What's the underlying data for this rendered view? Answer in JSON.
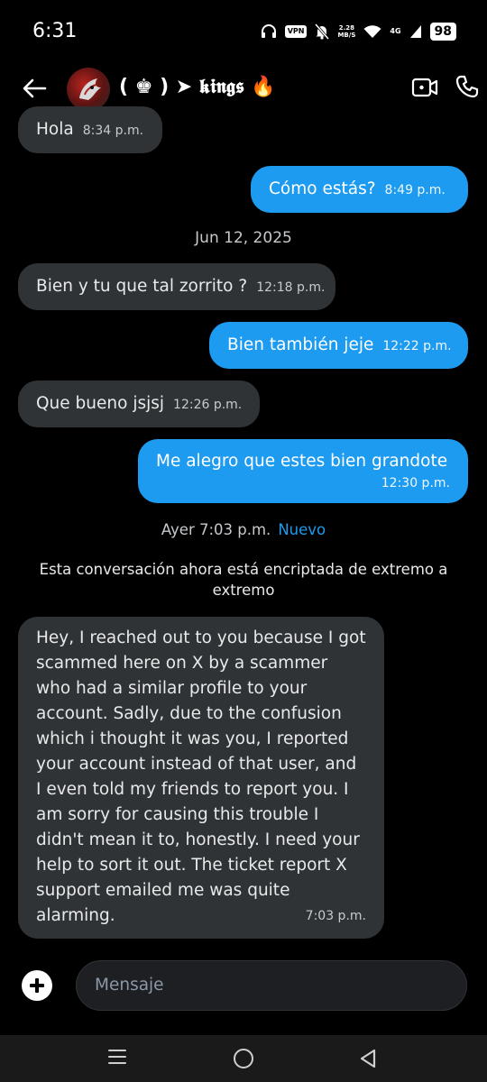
{
  "status_bar": {
    "time": "6:31",
    "vpn": "VPN",
    "speed_top": "2.28",
    "speed_bottom": "MB/S",
    "network": "4G",
    "battery": "98"
  },
  "header": {
    "title": "( ♚ ) ➤ 𝖐𝖎𝖓𝖌𝖘 🔥"
  },
  "messages": [
    {
      "side": "in",
      "text": "Hola",
      "time": "8:34 p.m."
    },
    {
      "side": "out",
      "text": "Cómo estás?",
      "time": "8:49 p.m."
    },
    {
      "side": "in",
      "text": "Bien y tu que tal zorrito ?",
      "time": "12:18 p.m."
    },
    {
      "side": "out",
      "text": "Bien también jeje",
      "time": "12:22 p.m."
    },
    {
      "side": "in",
      "text": "Que bueno jsjsj",
      "time": "12:26 p.m."
    },
    {
      "side": "out",
      "text": "Me alegro que estes bien grandote",
      "time": "12:30 p.m."
    },
    {
      "side": "in",
      "text": "Hey, I reached out to you because I got scammed here on X by a scammer who had a similar profile to your account. Sadly, due to the confusion which i thought it was you, I reported your account instead of that user, and I even told my friends to report you. I am sorry for causing this trouble I didn't mean it to, honestly. I need your help to sort it out. The ticket report X support emailed me was quite alarming.",
      "time": "7:03 p.m."
    }
  ],
  "date_separator": "Jun 12, 2025",
  "new_separator": {
    "label": "Ayer 7:03 p.m.",
    "tag": "Nuevo"
  },
  "encryption_notice": "Esta conversación ahora está encriptada de extremo a extremo",
  "composer": {
    "placeholder": "Mensaje"
  },
  "colors": {
    "accent": "#1d9bf0",
    "incoming_bubble": "#2f3336",
    "background": "#000000"
  }
}
